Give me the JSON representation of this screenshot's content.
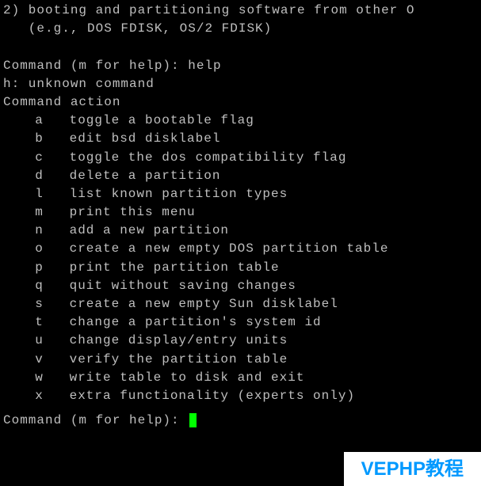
{
  "header": {
    "line1": "2) booting and partitioning software from other O",
    "line2": "   (e.g., DOS FDISK, OS/2 FDISK)"
  },
  "prompt1": {
    "prompt": "Command (m for help): ",
    "input": "help"
  },
  "error": "h: unknown command",
  "action_title": "Command action",
  "commands": [
    {
      "key": "a",
      "desc": "toggle a bootable flag"
    },
    {
      "key": "b",
      "desc": "edit bsd disklabel"
    },
    {
      "key": "c",
      "desc": "toggle the dos compatibility flag"
    },
    {
      "key": "d",
      "desc": "delete a partition"
    },
    {
      "key": "l",
      "desc": "list known partition types"
    },
    {
      "key": "m",
      "desc": "print this menu"
    },
    {
      "key": "n",
      "desc": "add a new partition"
    },
    {
      "key": "o",
      "desc": "create a new empty DOS partition table"
    },
    {
      "key": "p",
      "desc": "print the partition table"
    },
    {
      "key": "q",
      "desc": "quit without saving changes"
    },
    {
      "key": "s",
      "desc": "create a new empty Sun disklabel"
    },
    {
      "key": "t",
      "desc": "change a partition's system id"
    },
    {
      "key": "u",
      "desc": "change display/entry units"
    },
    {
      "key": "v",
      "desc": "verify the partition table"
    },
    {
      "key": "w",
      "desc": "write table to disk and exit"
    },
    {
      "key": "x",
      "desc": "extra functionality (experts only)"
    }
  ],
  "prompt2": {
    "prompt": "Command (m for help): ",
    "cursor_color": "#00ff00"
  },
  "watermark": "VEPHP教程"
}
